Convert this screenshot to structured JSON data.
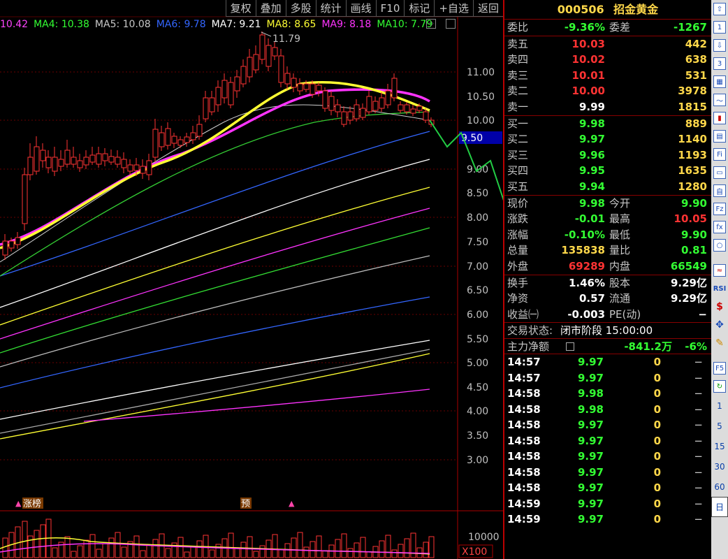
{
  "toolbar": [
    "复权",
    "叠加",
    "多股",
    "统计",
    "画线",
    "F10",
    "标记",
    "+自选",
    "返回"
  ],
  "ma_legend": [
    {
      "label": "10.42",
      "color": "#ff44ff"
    },
    {
      "label": "MA4: 10.38",
      "color": "#33ff33"
    },
    {
      "label": "MA5: 10.08",
      "color": "#c8c8c8"
    },
    {
      "label": "MA6: 9.78",
      "color": "#3366ff"
    },
    {
      "label": "MA7: 9.21",
      "color": "#ffffff"
    },
    {
      "label": "MA8: 8.65",
      "color": "#ffff33"
    },
    {
      "label": "MA9: 8.18",
      "color": "#ff33ff"
    },
    {
      "label": "MA10: 7.79",
      "color": "#33ff33"
    }
  ],
  "chart": {
    "price_ticks": [
      "11.00",
      "10.50",
      "10.00",
      "9.50",
      "9.00",
      "8.50",
      "8.00",
      "7.50",
      "7.00",
      "6.50",
      "6.00",
      "5.50",
      "5.00",
      "4.50",
      "4.00",
      "3.50",
      "3.00"
    ],
    "high_label": "11.79",
    "current_price_tag": "9.50",
    "volume_tick": "10000",
    "volume_unit": "X100",
    "markers": {
      "zhangbang": "涨榜",
      "yu": "预"
    }
  },
  "quote": {
    "code": "000506",
    "name": "招金黄金",
    "weibi_label": "委比",
    "weibi": "-9.36%",
    "weicha_label": "委差",
    "weicha": "-1267",
    "sell": [
      {
        "label": "卖五",
        "price": "10.03",
        "vol": "442"
      },
      {
        "label": "卖四",
        "price": "10.02",
        "vol": "638"
      },
      {
        "label": "卖三",
        "price": "10.01",
        "vol": "531"
      },
      {
        "label": "卖二",
        "price": "10.00",
        "vol": "3978"
      },
      {
        "label": "卖一",
        "price": "9.99",
        "vol": "1815"
      }
    ],
    "buy": [
      {
        "label": "买一",
        "price": "9.98",
        "vol": "889"
      },
      {
        "label": "买二",
        "price": "9.97",
        "vol": "1140"
      },
      {
        "label": "买三",
        "price": "9.96",
        "vol": "1193"
      },
      {
        "label": "买四",
        "price": "9.95",
        "vol": "1635"
      },
      {
        "label": "买五",
        "price": "9.94",
        "vol": "1280"
      }
    ],
    "stats": [
      {
        "l1": "现价",
        "v1": "9.98",
        "c1": "green",
        "l2": "今开",
        "v2": "9.90",
        "c2": "green"
      },
      {
        "l1": "涨跌",
        "v1": "-0.01",
        "c1": "green",
        "l2": "最高",
        "v2": "10.05",
        "c2": "red"
      },
      {
        "l1": "涨幅",
        "v1": "-0.10%",
        "c1": "green",
        "l2": "最低",
        "v2": "9.90",
        "c2": "green"
      },
      {
        "l1": "总量",
        "v1": "135838",
        "c1": "yellow",
        "l2": "量比",
        "v2": "0.81",
        "c2": "green"
      },
      {
        "l1": "外盘",
        "v1": "69289",
        "c1": "red",
        "l2": "内盘",
        "v2": "66549",
        "c2": "green"
      }
    ],
    "stats2": [
      {
        "l1": "换手",
        "v1": "1.46%",
        "l2": "股本",
        "v2": "9.29亿"
      },
      {
        "l1": "净资",
        "v1": "0.57",
        "l2": "流通",
        "v2": "9.29亿"
      },
      {
        "l1": "收益㈠",
        "v1": "-0.003",
        "l2": "PE(动)",
        "v2": "−"
      }
    ],
    "trade_status_label": "交易状态:",
    "trade_status": "闭市阶段 15:00:00",
    "main_flow_label": "主力净额",
    "main_flow": "-841.2万",
    "main_flow_pct": "-6%"
  },
  "ticks": [
    {
      "time": "14:57",
      "price": "9.97",
      "vol": "0",
      "dir": "−"
    },
    {
      "time": "14:57",
      "price": "9.97",
      "vol": "0",
      "dir": "−"
    },
    {
      "time": "14:58",
      "price": "9.98",
      "vol": "0",
      "dir": "−"
    },
    {
      "time": "14:58",
      "price": "9.98",
      "vol": "0",
      "dir": "−"
    },
    {
      "time": "14:58",
      "price": "9.97",
      "vol": "0",
      "dir": "−"
    },
    {
      "time": "14:58",
      "price": "9.97",
      "vol": "0",
      "dir": "−"
    },
    {
      "time": "14:58",
      "price": "9.97",
      "vol": "0",
      "dir": "−"
    },
    {
      "time": "14:58",
      "price": "9.97",
      "vol": "0",
      "dir": "−"
    },
    {
      "time": "14:58",
      "price": "9.97",
      "vol": "0",
      "dir": "−"
    },
    {
      "time": "14:59",
      "price": "9.97",
      "vol": "0",
      "dir": "−"
    },
    {
      "time": "14:59",
      "price": "9.97",
      "vol": "0",
      "dir": "−"
    }
  ],
  "sidebar_periods": [
    "1",
    "5",
    "15",
    "30",
    "60",
    "日"
  ]
}
